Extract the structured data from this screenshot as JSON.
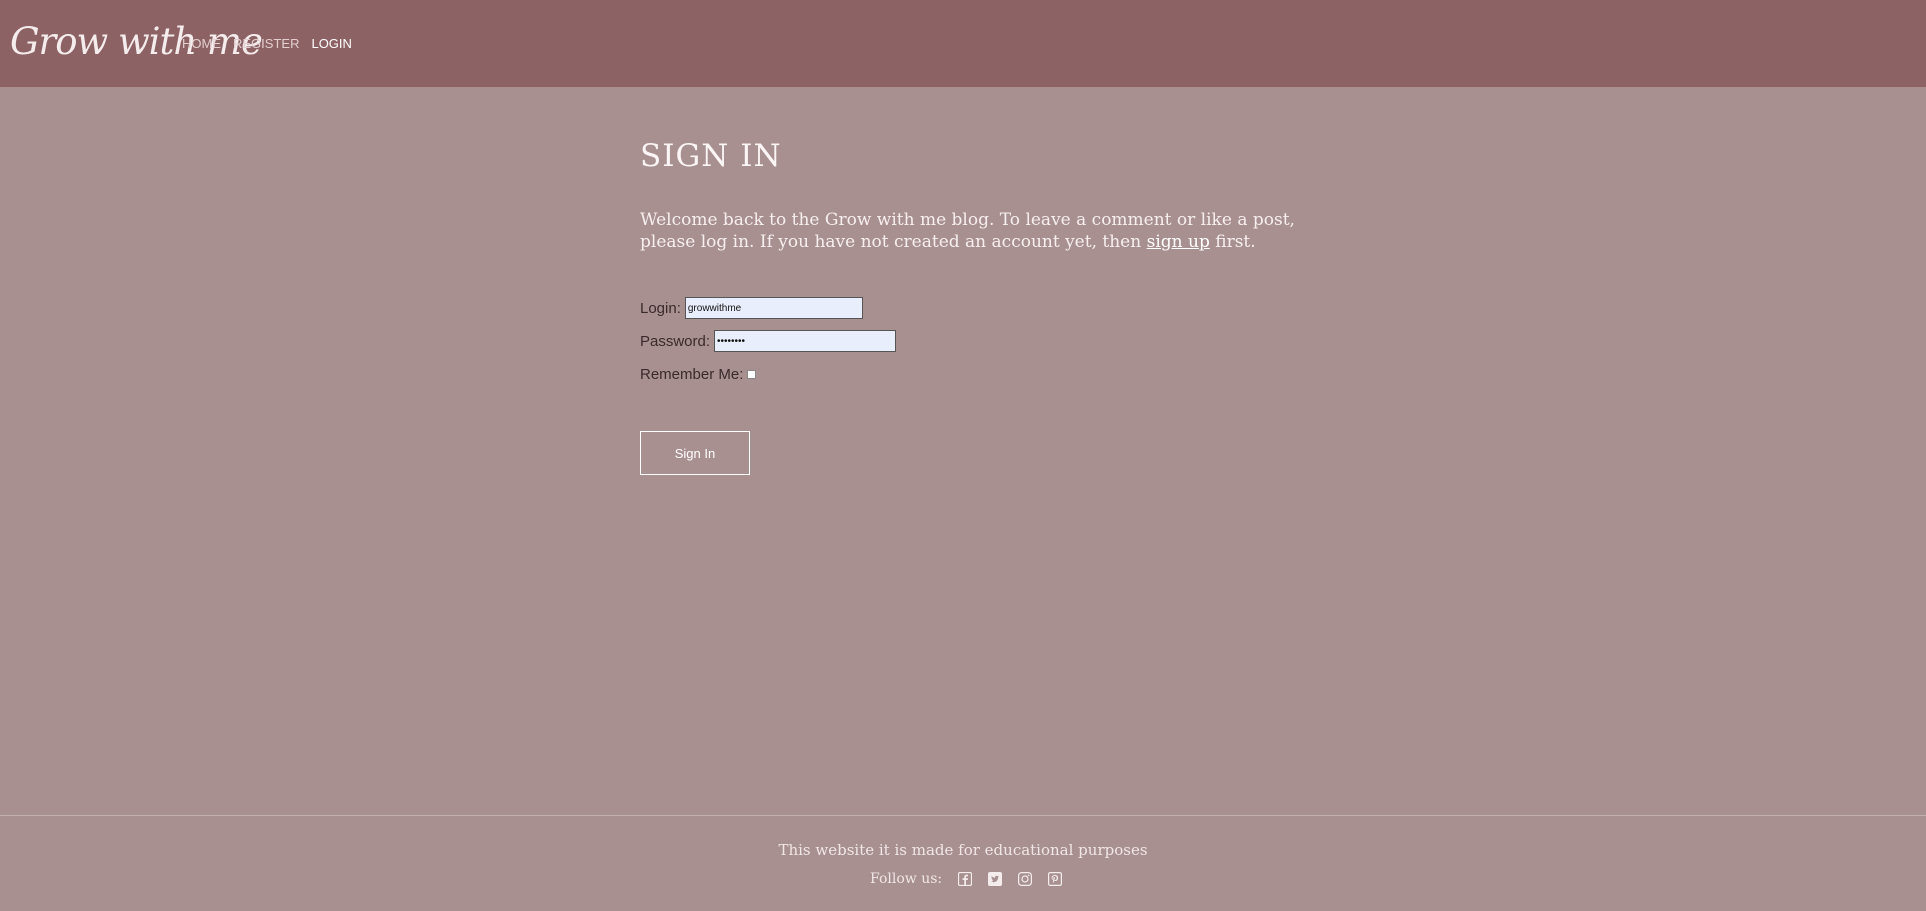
{
  "header": {
    "brand": "Grow with me",
    "nav": [
      {
        "label": "HOME"
      },
      {
        "label": "REGISTER"
      },
      {
        "label": "LOGIN"
      }
    ]
  },
  "main": {
    "title": "SIGN IN",
    "intro_before": "Welcome back to the Grow with me blog. To leave a comment or like a post, please log in. If you have not created an account yet, then ",
    "intro_link": "sign up",
    "intro_after": " first."
  },
  "form": {
    "login_label": "Login:",
    "login_value": "growwithme",
    "password_label": "Password:",
    "password_value": "••••••••",
    "remember_label": "Remember Me:",
    "remember_checked": false,
    "submit_label": "Sign In"
  },
  "footer": {
    "note": "This website it is made for educational purposes",
    "follow_label": "Follow us:",
    "social_icons": [
      "facebook-icon",
      "twitter-icon",
      "instagram-icon",
      "pinterest-icon"
    ]
  },
  "colors": {
    "header_bg": "#8d6265",
    "page_bg": "#a89090",
    "input_bg": "#e8eefb"
  }
}
